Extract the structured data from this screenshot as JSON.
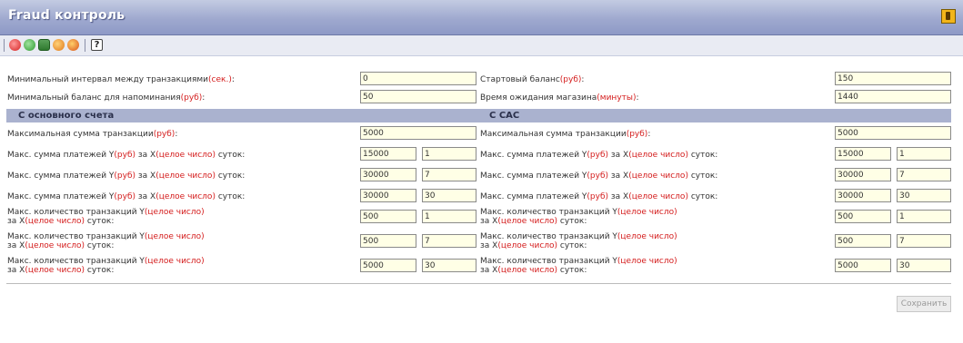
{
  "window": {
    "title": "Fraud контроль"
  },
  "toolbar": {
    "icons": [
      "stop-icon",
      "go-icon",
      "list-icon",
      "refresh-icon",
      "info-icon",
      "help-icon"
    ],
    "help_glyph": "?"
  },
  "fields": {
    "min_interval": {
      "label": "Минимальный интервал между транзакциями",
      "unit": "(сек.)",
      "tail": ":",
      "value": "0"
    },
    "start_balance": {
      "label": "Стартовый баланс",
      "unit": "(руб)",
      "tail": ":",
      "value": "150"
    },
    "min_balance_notify": {
      "label": "Минимальный баланс для напоминания",
      "unit": "(руб)",
      "tail": ":",
      "value": "50"
    },
    "shop_wait_time": {
      "label": "Время ожидания магазина",
      "unit": "(минуты)",
      "tail": ":",
      "value": "1440"
    }
  },
  "sections": {
    "left": "С основного счета",
    "right": "С CAC"
  },
  "text": {
    "max_sum_label": "Максимальная сумма транзакции",
    "max_pay_label": "Макс. сумма платежей Y",
    "for_x": " за X",
    "days": " суток:",
    "colon": ":",
    "rub": "(руб)",
    "int": "(целое число)",
    "max_count_label": "Макс. количество транзакций Y",
    "for_x_line2": "за X"
  },
  "left": {
    "max_sum": "5000",
    "pay_rows": [
      {
        "y": "15000",
        "x": "1"
      },
      {
        "y": "30000",
        "x": "7"
      },
      {
        "y": "30000",
        "x": "30"
      }
    ],
    "count_rows": [
      {
        "y": "500",
        "x": "1"
      },
      {
        "y": "500",
        "x": "7"
      },
      {
        "y": "5000",
        "x": "30"
      }
    ]
  },
  "right": {
    "max_sum": "5000",
    "pay_rows": [
      {
        "y": "15000",
        "x": "1"
      },
      {
        "y": "30000",
        "x": "7"
      },
      {
        "y": "30000",
        "x": "30"
      }
    ],
    "count_rows": [
      {
        "y": "500",
        "x": "1"
      },
      {
        "y": "500",
        "x": "7"
      },
      {
        "y": "5000",
        "x": "30"
      }
    ]
  },
  "buttons": {
    "save": "Сохранить"
  }
}
